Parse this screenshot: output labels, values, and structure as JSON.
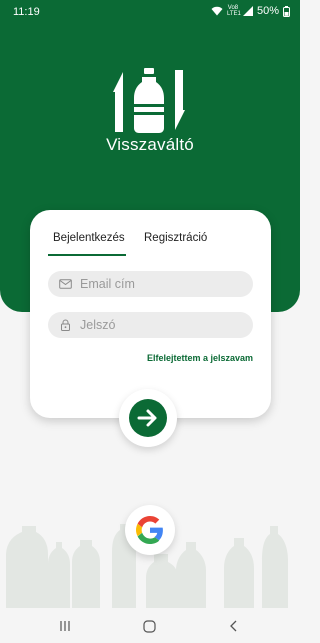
{
  "status_bar": {
    "time": "11:19",
    "network_label_top": "Vo8",
    "network_label_bottom": "LTE1",
    "battery": "50%"
  },
  "app": {
    "title": "Visszaváltó",
    "brand_color": "#0b6a35"
  },
  "tabs": [
    {
      "label": "Bejelentkezés",
      "active": true
    },
    {
      "label": "Regisztráció",
      "active": false
    }
  ],
  "form": {
    "email_placeholder": "Email cím",
    "email_value": "",
    "password_placeholder": "Jelszó",
    "password_value": "",
    "forgot_password": "Elfelejtettem a jelszavam"
  },
  "icons": {
    "logo": "bottle-exchange-logo",
    "email": "mail-icon",
    "password": "lock-icon",
    "submit": "arrow-right-icon",
    "google": "google-icon"
  }
}
